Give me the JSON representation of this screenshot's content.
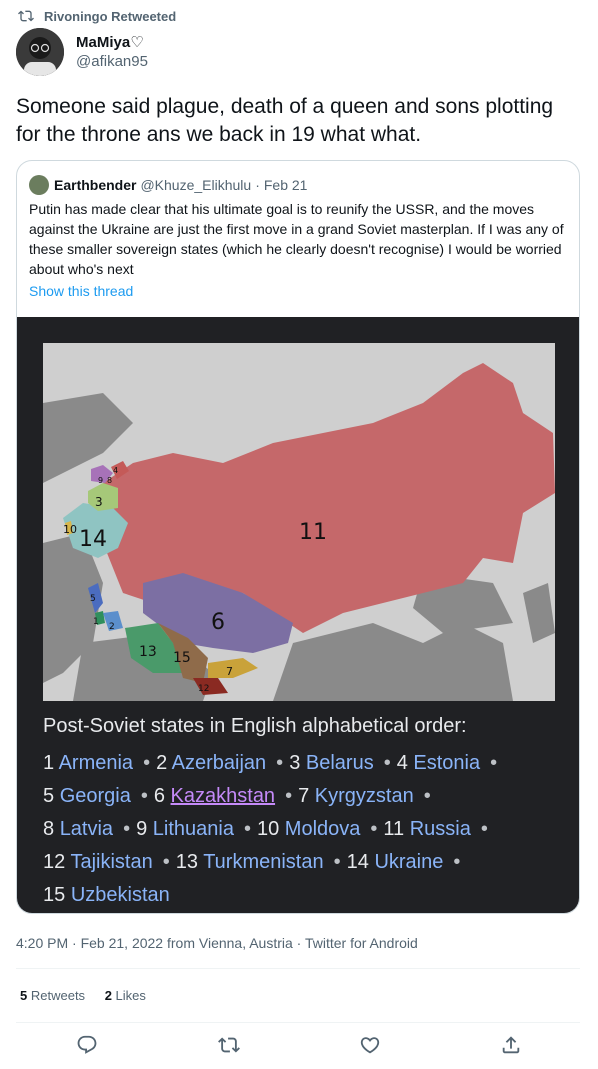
{
  "retweet": {
    "label": "Rivoningo Retweeted"
  },
  "author": {
    "name": "MaMiya",
    "heart": "♡",
    "handle": "@afikan95"
  },
  "tweet": {
    "text": "Someone said plague, death of a queen and sons plotting for the throne ans we back in 19 what what."
  },
  "quote": {
    "name": "Earthbender",
    "handle": "@Khuze_Elikhulu",
    "separator": "·",
    "date": "Feb 21",
    "text": "Putin has made clear that his ultimate goal is to reunify the USSR, and the moves against the Ukraine are just the first move in a grand Soviet masterplan. If I was any of these smaller sovereign states (which he clearly doesn't recognise) I would be worried about who's next",
    "show_thread": "Show this thread"
  },
  "media": {
    "map_labels": [
      "1",
      "2",
      "3",
      "4",
      "5",
      "6",
      "7",
      "8",
      "9",
      "10",
      "11",
      "12",
      "13",
      "14",
      "15"
    ],
    "legend_title": "Post-Soviet states in English alphabetical order:",
    "legend": [
      {
        "n": "1",
        "name": "Armenia"
      },
      {
        "n": "2",
        "name": "Azerbaijan"
      },
      {
        "n": "3",
        "name": "Belarus"
      },
      {
        "n": "4",
        "name": "Estonia"
      },
      {
        "n": "5",
        "name": "Georgia"
      },
      {
        "n": "6",
        "name": "Kazakhstan"
      },
      {
        "n": "7",
        "name": "Kyrgyzstan"
      },
      {
        "n": "8",
        "name": "Latvia"
      },
      {
        "n": "9",
        "name": "Lithuania"
      },
      {
        "n": "10",
        "name": "Moldova"
      },
      {
        "n": "11",
        "name": "Russia"
      },
      {
        "n": "12",
        "name": "Tajikistan"
      },
      {
        "n": "13",
        "name": "Turkmenistan"
      },
      {
        "n": "14",
        "name": "Ukraine"
      },
      {
        "n": "15",
        "name": "Uzbekistan"
      }
    ],
    "bullet": "•"
  },
  "timestamp": "4:20 PM · Feb 21, 2022 from Vienna, Austria · Twitter for Android",
  "stats": {
    "retweets_count": "5",
    "retweets_label": "Retweets",
    "likes_count": "2",
    "likes_label": "Likes"
  },
  "colors": {
    "russia": "#c5686a",
    "kazakhstan": "#7c6fa3",
    "ukraine": "#8fc4c2",
    "link": "#1d9bf0"
  },
  "icons": [
    "retweet-icon",
    "reply-icon",
    "retweet-icon",
    "like-icon",
    "share-icon"
  ]
}
